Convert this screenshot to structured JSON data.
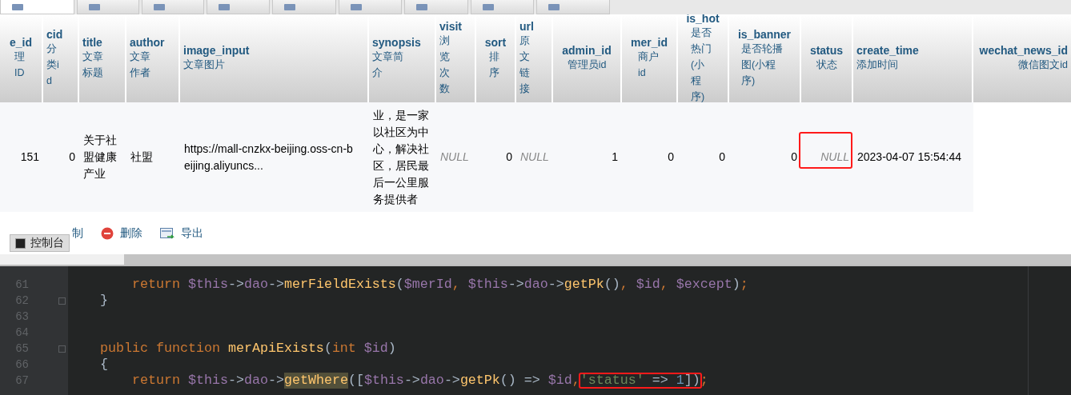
{
  "tabs": [
    {
      "selected": true
    },
    {
      "selected": false
    },
    {
      "selected": false
    },
    {
      "selected": false
    },
    {
      "selected": false
    },
    {
      "selected": false
    },
    {
      "selected": false
    },
    {
      "selected": false
    },
    {
      "selected": false
    }
  ],
  "table": {
    "columns": [
      {
        "name": "e_id",
        "comment": "理ID"
      },
      {
        "name": "cid",
        "comment": "分类id"
      },
      {
        "name": "title",
        "comment": "文章标题"
      },
      {
        "name": "author",
        "comment": "文章作者"
      },
      {
        "name": "image_input",
        "comment": "文章图片"
      },
      {
        "name": "synopsis",
        "comment": "文章简介"
      },
      {
        "name": "visit",
        "comment": "浏览次数"
      },
      {
        "name": "sort",
        "comment": "排序"
      },
      {
        "name": "url",
        "comment": "原文链接"
      },
      {
        "name": "admin_id",
        "comment": "管理员id"
      },
      {
        "name": "mer_id",
        "comment": "商户id"
      },
      {
        "name": "is_hot",
        "comment": "是否热门(小程序)"
      },
      {
        "name": "is_banner",
        "comment": "是否轮播图(小程序)"
      },
      {
        "name": "status",
        "comment": "状态"
      },
      {
        "name": "create_time",
        "comment": "添加时间"
      },
      {
        "name": "wechat_news_id",
        "comment": "微信图文id"
      }
    ],
    "rows": [
      {
        "cells": [
          {
            "kind": "number",
            "text": "151"
          },
          {
            "kind": "number",
            "text": "0"
          },
          {
            "kind": "text",
            "text": "关于社盟健康产业"
          },
          {
            "kind": "text",
            "text": "社盟"
          },
          {
            "kind": "text",
            "text": "https://mall-cnzkx-beijing.oss-cn-beijing.aliyuncs..."
          },
          {
            "kind": "text",
            "text": "业，是一家以社区为中心，解决社区，居民最后一公里服务提供者"
          },
          {
            "kind": "null",
            "text": "NULL"
          },
          {
            "kind": "number",
            "text": "0"
          },
          {
            "kind": "null",
            "text": "NULL"
          },
          {
            "kind": "number",
            "text": "1"
          },
          {
            "kind": "number",
            "text": "0"
          },
          {
            "kind": "number",
            "text": "0"
          },
          {
            "kind": "number",
            "text": "0"
          },
          {
            "kind": "null",
            "text": "NULL",
            "highlighted": true
          },
          {
            "kind": "text",
            "text": "2023-04-07 15:54:44"
          },
          {
            "kind": "empty"
          }
        ]
      }
    ]
  },
  "actions": [
    {
      "kind": "copy",
      "label": "制"
    },
    {
      "kind": "delete",
      "label": "删除"
    },
    {
      "kind": "export",
      "label": "导出"
    }
  ],
  "console_button": {
    "label": "控制台"
  },
  "code": {
    "lines": [
      {
        "number": "61",
        "tokens": [
          {
            "kind": "kw",
            "text": "        return "
          },
          {
            "kind": "var",
            "text": "$this"
          },
          {
            "kind": "punct",
            "text": "->"
          },
          {
            "kind": "var",
            "text": "dao"
          },
          {
            "kind": "punct",
            "text": "->"
          },
          {
            "kind": "fn",
            "text": "merFieldExists"
          },
          {
            "kind": "punct",
            "text": "("
          },
          {
            "kind": "var",
            "text": "$merId"
          },
          {
            "kind": "kw",
            "text": ", "
          },
          {
            "kind": "var",
            "text": "$this"
          },
          {
            "kind": "punct",
            "text": "->"
          },
          {
            "kind": "var",
            "text": "dao"
          },
          {
            "kind": "punct",
            "text": "->"
          },
          {
            "kind": "fn",
            "text": "getPk"
          },
          {
            "kind": "punct",
            "text": "()"
          },
          {
            "kind": "kw",
            "text": ", "
          },
          {
            "kind": "var",
            "text": "$id"
          },
          {
            "kind": "kw",
            "text": ", "
          },
          {
            "kind": "var",
            "text": "$except"
          },
          {
            "kind": "punct",
            "text": ")"
          },
          {
            "kind": "kw",
            "text": ";"
          }
        ]
      },
      {
        "number": "62",
        "fold": true,
        "tokens": [
          {
            "kind": "punct",
            "text": "    }"
          }
        ]
      },
      {
        "number": "63"
      },
      {
        "number": "64"
      },
      {
        "number": "65",
        "fold": true,
        "tokens": [
          {
            "kind": "kw",
            "text": "    public function "
          },
          {
            "kind": "fn",
            "text": "merApiExists"
          },
          {
            "kind": "punct",
            "text": "("
          },
          {
            "kind": "kw",
            "text": "int "
          },
          {
            "kind": "var",
            "text": "$id"
          },
          {
            "kind": "punct",
            "text": ")"
          }
        ]
      },
      {
        "number": "66",
        "tokens": [
          {
            "kind": "punct",
            "text": "    {"
          }
        ]
      },
      {
        "number": "67",
        "tokens": [
          {
            "kind": "kw",
            "text": "        return "
          },
          {
            "kind": "var",
            "text": "$this"
          },
          {
            "kind": "punct",
            "text": "->"
          },
          {
            "kind": "var",
            "text": "dao"
          },
          {
            "kind": "punct",
            "text": "->"
          },
          {
            "kind": "fn",
            "text": "getWhere",
            "highlighted": true
          },
          {
            "kind": "punct",
            "text": "(["
          },
          {
            "kind": "var",
            "text": "$this"
          },
          {
            "kind": "punct",
            "text": "->"
          },
          {
            "kind": "var",
            "text": "dao"
          },
          {
            "kind": "punct",
            "text": "->"
          },
          {
            "kind": "fn",
            "text": "getPk"
          },
          {
            "kind": "punct",
            "text": "() => "
          },
          {
            "kind": "var",
            "text": "$id"
          },
          {
            "kind": "kw",
            "text": ","
          },
          {
            "kind": "str",
            "text": "'status'",
            "boxed": true
          },
          {
            "kind": "punct",
            "text": " => ",
            "boxed": true
          },
          {
            "kind": "num",
            "text": "1",
            "boxed": true
          },
          {
            "kind": "punct",
            "text": "])",
            "boxed": true
          },
          {
            "kind": "kw",
            "text": ";"
          }
        ]
      }
    ]
  }
}
